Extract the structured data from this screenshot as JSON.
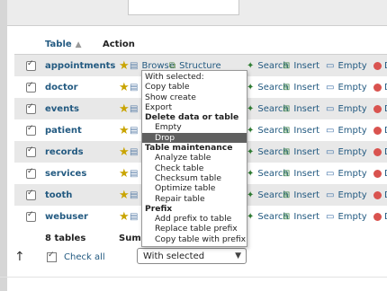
{
  "header": {
    "table_label": "Table",
    "sort_icon": "sort-asc-icon",
    "action_label": "Action"
  },
  "actions": {
    "browse": "Browse",
    "structure": "Structure",
    "search": "Search",
    "insert": "Insert",
    "empty": "Empty",
    "drop": "D"
  },
  "rows": [
    {
      "name": "appointments"
    },
    {
      "name": "doctor"
    },
    {
      "name": "events"
    },
    {
      "name": "patient"
    },
    {
      "name": "records"
    },
    {
      "name": "services"
    },
    {
      "name": "tooth"
    },
    {
      "name": "webuser"
    }
  ],
  "footer": {
    "count": "8 tables",
    "sum": "Sum"
  },
  "bottom": {
    "check_all": "Check all",
    "select_value": "With selected"
  },
  "menu": [
    {
      "label": "With selected:",
      "type": "item"
    },
    {
      "label": "Copy table",
      "type": "item"
    },
    {
      "label": "Show create",
      "type": "item"
    },
    {
      "label": "Export",
      "type": "item"
    },
    {
      "label": "Delete data or table",
      "type": "section"
    },
    {
      "label": "Empty",
      "type": "sub"
    },
    {
      "label": "Drop",
      "type": "sub",
      "highlighted": true
    },
    {
      "label": "Table maintenance",
      "type": "section"
    },
    {
      "label": "Analyze table",
      "type": "sub"
    },
    {
      "label": "Check table",
      "type": "sub"
    },
    {
      "label": "Checksum table",
      "type": "sub"
    },
    {
      "label": "Optimize table",
      "type": "sub"
    },
    {
      "label": "Repair table",
      "type": "sub"
    },
    {
      "label": "Prefix",
      "type": "section"
    },
    {
      "label": "Add prefix to table",
      "type": "sub"
    },
    {
      "label": "Replace table prefix",
      "type": "sub"
    },
    {
      "label": "Copy table with prefix",
      "type": "sub"
    }
  ],
  "colors": {
    "link": "#235a81",
    "highlight": "#5f5f5f",
    "row_alt": "#e8e8e8"
  }
}
